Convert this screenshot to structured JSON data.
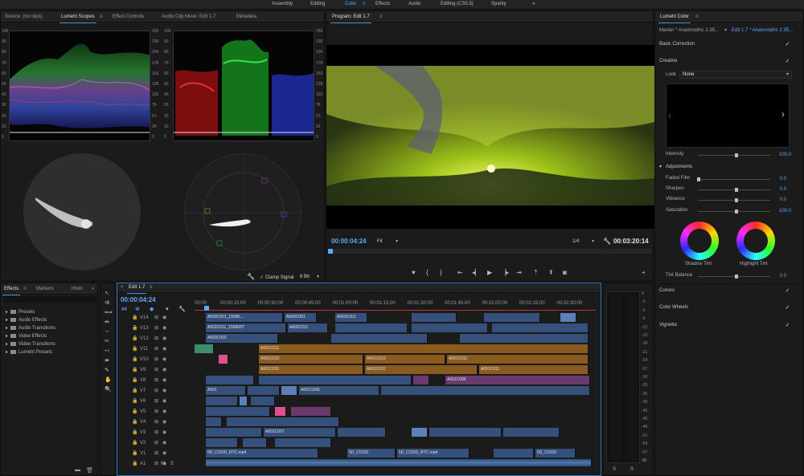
{
  "workspace": {
    "items": [
      "Assembly",
      "Editing",
      "Color",
      "Effects",
      "Audio",
      "Editing (CS5.5)",
      "Sparky"
    ],
    "active_index": 2,
    "more": "»"
  },
  "source_panel": {
    "tabs": [
      "Source: (no clips)",
      "Lumetri Scopes",
      "Effect Controls",
      "Audio Clip Mixer: Edit 1.7",
      "Metadata"
    ],
    "active_tab": 1,
    "waveform_left_scale": [
      "100",
      "90",
      "80",
      "70",
      "60",
      "50",
      "40",
      "30",
      "20",
      "10",
      "0"
    ],
    "waveform_right_scale": [
      "255",
      "230",
      "204",
      "178",
      "153",
      "128",
      "102",
      "76",
      "51",
      "26",
      "0"
    ],
    "clamp_signal": "✓ Clamp Signal",
    "bit_depth": "8 Bit"
  },
  "program": {
    "title": "Program: Edit 1.7",
    "timecode_current": "00:00:04:24",
    "fit": "Fit",
    "resolution": "1/4",
    "timecode_duration": "00:03:20:14"
  },
  "lumetri": {
    "title": "Lumetri Color",
    "master_label": "Master * Anamorphic 2.35...",
    "clip_label": "Edit 1.7 * Anamorphic 2.35...",
    "sections": {
      "basic": "Basic Correction",
      "creative": "Creative",
      "curves": "Curves",
      "color_wheels": "Color Wheels",
      "vignette": "Vignette"
    },
    "look_label": "Look",
    "look_value": "None",
    "intensity_label": "Intensity",
    "intensity_value": "100.0",
    "adjustments_label": "Adjustments",
    "faded_film_label": "Faded Film",
    "faded_film_value": "0.0",
    "sharpen_label": "Sharpen",
    "sharpen_value": "0.0",
    "vibrance_label": "Vibrance",
    "vibrance_value": "0.0",
    "saturation_label": "Saturation",
    "saturation_value": "100.0",
    "shadow_tint_label": "Shadow Tint",
    "highlight_tint_label": "Highlight Tint",
    "tint_balance_label": "Tint Balance",
    "tint_balance_value": "0.0"
  },
  "effects_panel": {
    "tabs": [
      "Effects",
      "Markers",
      "Histo"
    ],
    "more": "»",
    "items": [
      "Presets",
      "Audio Effects",
      "Audio Transitions",
      "Video Effects",
      "Video Transitions",
      "Lumetri Presets"
    ]
  },
  "timeline": {
    "tab": "Edit 1.7",
    "timecode": "00:00:04:24",
    "ruler": [
      "00:00",
      "00:00:15:00",
      "00:00:30:00",
      "00:00:45:00",
      "00:01:00:00",
      "00:01:15:00",
      "00:01:30:00",
      "00:01:45:00",
      "00:02:00:00",
      "00:02:15:00",
      "00:02:30:00"
    ],
    "tracks": [
      "V14",
      "V13",
      "V12",
      "V11",
      "V10",
      "V9",
      "V8",
      "V7",
      "V6",
      "V5",
      "V4",
      "V3",
      "V2",
      "V1",
      "A1"
    ],
    "clip_names": {
      "v14a": "A003C001_15080...",
      "v14b": "A003C001",
      "v14c": "A003C001",
      "v13a": "A002C011_150808T",
      "v13b": "A002C011",
      "v12": "A003C002",
      "v10a": "A001C011",
      "v10b": "A001C011",
      "v10c": "A001C011",
      "v9a": "A001C012",
      "v9b": "A001C012",
      "v8a": "A001C011",
      "v8b": "A001C011",
      "v7": "A001C006",
      "v6a": "A001",
      "v6b": "A001C006",
      "v2": "A001C007",
      "a1a": "5D_COOD_RTC.mp4",
      "a1b": "5D_COOD",
      "a1c": "5D_COOD_RTC.mp4",
      "a1d": "5D_COOD"
    },
    "footer_labels": [
      "M",
      "S"
    ]
  },
  "meter": {
    "scale": [
      "0",
      "-3",
      "-6",
      "-9",
      "-12",
      "-15",
      "-18",
      "-21",
      "-24",
      "-27",
      "-30",
      "-33",
      "-36",
      "-39",
      "-42",
      "-45",
      "-48",
      "-51",
      "-54",
      "-57",
      "dB"
    ],
    "solo_left": "S",
    "solo_right": "S"
  },
  "colors": {
    "accent": "#5aa9ff",
    "panel_bg": "#1b1b1b",
    "clip_blue": "#35507a",
    "clip_orange": "#8a5a1e",
    "clip_pink": "#e0508f"
  }
}
